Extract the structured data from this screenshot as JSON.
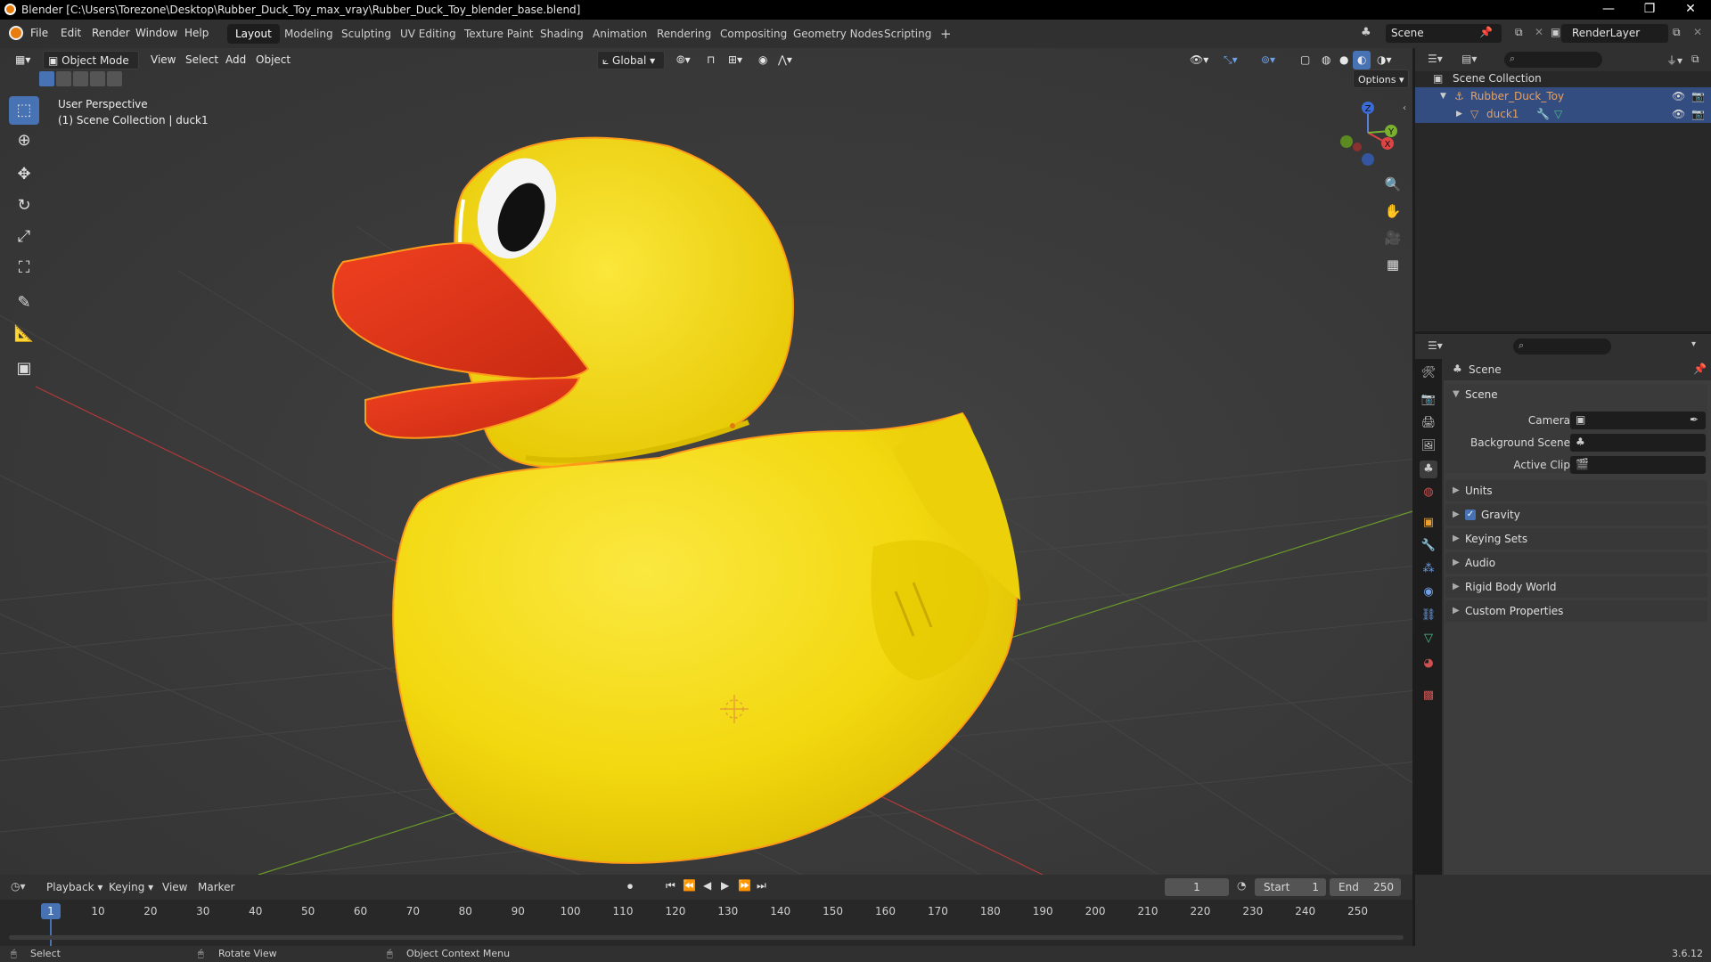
{
  "window": {
    "title": "Blender [C:\\Users\\Torezone\\Desktop\\Rubber_Duck_Toy_max_vray\\Rubber_Duck_Toy_blender_base.blend]",
    "controls": [
      "—",
      "❐",
      "✕"
    ]
  },
  "menu": {
    "items": [
      "File",
      "Edit",
      "Render",
      "Window",
      "Help"
    ]
  },
  "workspaces": {
    "tabs": [
      "Layout",
      "Modeling",
      "Sculpting",
      "UV Editing",
      "Texture Paint",
      "Shading",
      "Animation",
      "Rendering",
      "Compositing",
      "Geometry Nodes",
      "Scripting"
    ],
    "active": "Layout",
    "add": "+"
  },
  "scene_selector": {
    "value": "Scene"
  },
  "view_layer_selector": {
    "value": "RenderLayer"
  },
  "viewport": {
    "mode": "Object Mode",
    "menus": [
      "View",
      "Select",
      "Add",
      "Object"
    ],
    "orientation": "Global",
    "options_label": "Options",
    "info_line1": "User Perspective",
    "info_line2": "(1) Scene Collection | duck1",
    "gizmo_labels": {
      "z": "Z",
      "y": "Y",
      "x": "X"
    }
  },
  "outliner": {
    "root": "Scene Collection",
    "rows": [
      {
        "label": "Rubber_Duck_Toy",
        "color": "#e8a060"
      },
      {
        "label": "duck1",
        "color": "#e8a060"
      }
    ]
  },
  "properties": {
    "header_title": "Scene",
    "section_open": "Scene",
    "fields": [
      {
        "label": "Camera"
      },
      {
        "label": "Background Scene"
      },
      {
        "label": "Active Clip"
      }
    ],
    "panels": [
      "Units",
      "Gravity",
      "Keying Sets",
      "Audio",
      "Rigid Body World",
      "Custom Properties"
    ],
    "gravity_checked": true
  },
  "timeline": {
    "menus": [
      "Playback",
      "Keying",
      "View",
      "Marker"
    ],
    "current_frame": "1",
    "start_label": "Start",
    "start": "1",
    "end_label": "End",
    "end": "250",
    "ticks": [
      "10",
      "20",
      "30",
      "40",
      "50",
      "60",
      "70",
      "80",
      "90",
      "100",
      "110",
      "120",
      "130",
      "140",
      "150",
      "160",
      "170",
      "180",
      "190",
      "200",
      "210",
      "220",
      "230",
      "240",
      "250"
    ],
    "playhead": "1"
  },
  "status": {
    "select": "Select",
    "rotate": "Rotate View",
    "context": "Object Context Menu",
    "version": "3.6.12"
  },
  "colors": {
    "accent": "#4772b3",
    "duck_body": "#f2d80f",
    "duck_beak": "#e8361c",
    "selection_outline": "#ff9a1a"
  }
}
